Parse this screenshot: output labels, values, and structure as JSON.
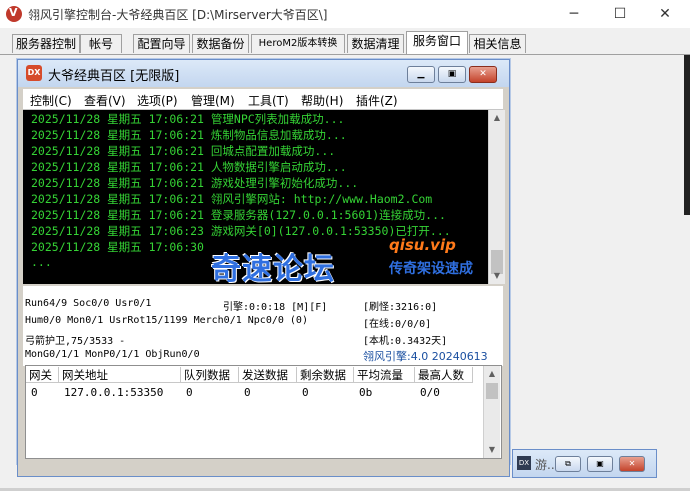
{
  "window": {
    "title": "翎风引擎控制台-大爷经典百区 [D:\\Mirserver大爷百区\\]",
    "minimize": "─",
    "maximize": "☐",
    "close": "✕"
  },
  "tabs": [
    {
      "label": "服务器控制"
    },
    {
      "label": "帐号"
    },
    {
      "label": "配置向导"
    },
    {
      "label": "数据备份"
    },
    {
      "label": "HeroM2版本转换"
    },
    {
      "label": "数据清理"
    },
    {
      "label": "服务窗口"
    },
    {
      "label": "相关信息"
    }
  ],
  "active_tab": "服务窗口",
  "mdi": {
    "icon_text": "DX",
    "title": "大爷经典百区 [无限版]",
    "menu": [
      {
        "label": "控制(C)"
      },
      {
        "label": "查看(V)"
      },
      {
        "label": "选项(P)"
      },
      {
        "label": "管理(M)"
      },
      {
        "label": "工具(T)"
      },
      {
        "label": "帮助(H)"
      },
      {
        "label": "插件(Z)"
      }
    ]
  },
  "log": [
    "2025/11/28 星期五 17:06:21 管理NPC列表加载成功...",
    "2025/11/28 星期五 17:06:21 炼制物品信息加载成功...",
    "2025/11/28 星期五 17:06:21 回城点配置加载成功...",
    "2025/11/28 星期五 17:06:21 人物数据引擎启动成功...",
    "2025/11/28 星期五 17:06:21 游戏处理引擎初始化成功...",
    "2025/11/28 星期五 17:06:21 翎风引擎网站: http://www.Haom2.Com",
    "2025/11/28 星期五 17:06:21 登录服务器(127.0.0.1:5601)连接成功...",
    "2025/11/28 星期五 17:06:23 游戏网关[0](127.0.0.1:53350)已打开...",
    "2025/11/28 星期五 17:06:30",
    "..."
  ],
  "watermark": {
    "main": "奇速论坛",
    "url": "qisu.vip",
    "sub": "传奇架设速成"
  },
  "status": {
    "left1": "Run64/9 Soc0/0 Usr0/1",
    "engine": "引擎:0:0:18 [M][F]",
    "refresh": "[刷怪:3216:0]",
    "left2": "Hum0/0 Mon0/1 UsrRot15/1199 Merch0/1 Npc0/0 (0)",
    "online": "[在线:0/0/0]",
    "left3": "弓箭护卫,75/3533 -",
    "local": "[本机:0.3432天]",
    "left4": "MonG0/1/1 MonP0/1/1 ObjRun0/0",
    "version": "翎风引擎:4.0 20240613"
  },
  "table": {
    "headers": [
      "网关",
      "网关地址",
      "队列数据",
      "发送数据",
      "剩余数据",
      "平均流量",
      "最高人数"
    ],
    "rows": [
      [
        "0",
        "127.0.0.1:53350",
        "0",
        "0",
        "0",
        "0b",
        "0/0"
      ]
    ]
  },
  "minimized": {
    "title": "游...",
    "icon_text": "DX"
  }
}
